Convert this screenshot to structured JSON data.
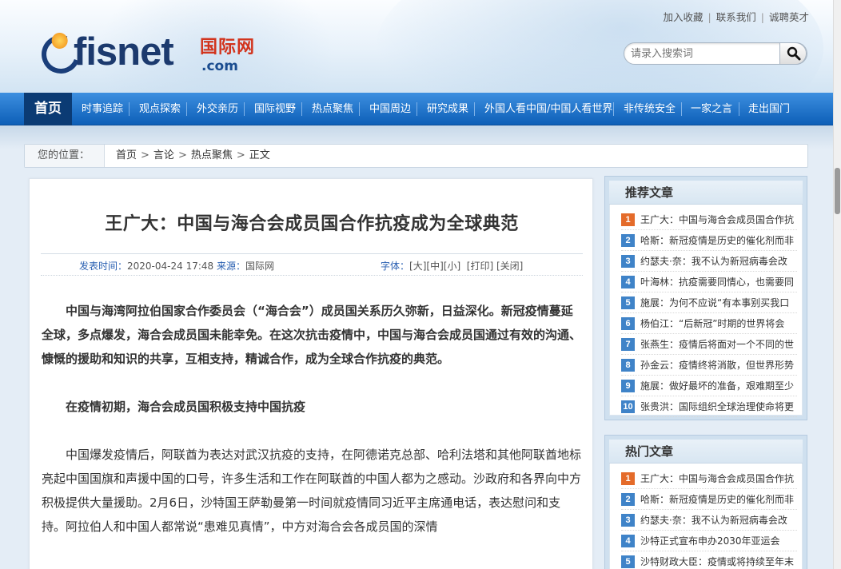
{
  "top_links": [
    "加入收藏",
    "联系我们",
    "诚聘英才"
  ],
  "top_links_sep": "|",
  "logo": {
    "brand": "fisnet",
    "cn": "国际网",
    "domain": ".com"
  },
  "search": {
    "placeholder": "请录入搜索词"
  },
  "nav": {
    "home": "首页",
    "items": [
      "时事追踪",
      "观点探索",
      "外交亲历",
      "国际视野",
      "热点聚焦",
      "中国周边",
      "研究成果",
      "外国人看中国/中国人看世界",
      "非传统安全",
      "一家之言",
      "走出国门"
    ]
  },
  "breadcrumb": {
    "label": "您的位置：",
    "path": [
      "首页",
      "言论",
      "热点聚焦",
      "正文"
    ],
    "sep": ">"
  },
  "article": {
    "title": "王广大：中国与海合会成员国合作抗疫成为全球典范",
    "publish_label": "发表时间：",
    "publish_time": "2020-04-24 17:48",
    "source_label": "来源：",
    "source": "国际网",
    "font_label": "字体：",
    "font_sizes": [
      "[大]",
      "[中]",
      "[小]"
    ],
    "print": "[打印]",
    "close": "[关闭]",
    "paragraphs": [
      "中国与海湾阿拉伯国家合作委员会（“海合会”）成员国关系历久弥新，日益深化。新冠疫情蔓延全球，多点爆发，海合会成员国未能幸免。在这次抗击疫情中，中国与海合会成员国通过有效的沟通、慷慨的援助和知识的共享，互相支持，精诚合作，成为全球合作抗疫的典范。",
      "在疫情初期，海合会成员国积极支持中国抗疫",
      "中国爆发疫情后，阿联酋为表达对武汉抗疫的支持，在阿德诺克总部、哈利法塔和其他阿联酋地标亮起中国国旗和声援中国的口号，许多生活和工作在阿联酋的中国人都为之感动。沙政府和各界向中方积极提供大量援助。2月6日，沙特国王萨勒曼第一时间就疫情同习近平主席通电话，表达慰问和支持。阿拉伯人和中国人都常说“患难见真情”，中方对海合会各成员国的深情"
    ]
  },
  "recommended": {
    "title": "推荐文章",
    "items": [
      "王广大：中国与海合会成员国合作抗",
      "哈斯：新冠疫情是历史的催化剂而非",
      "约瑟夫·奈：我不认为新冠病毒会改",
      "叶海林：抗疫需要同情心，也需要同",
      "施展：为何不应说“有本事别买我口",
      "杨伯江：“后新冠”时期的世界将会",
      "张燕生：疫情后将面对一个不同的世",
      "孙金云：疫情终将消散，但世界形势",
      "施展：做好最坏的准备，艰难期至少",
      "张贵洪：国际组织全球治理使命将更"
    ]
  },
  "hot": {
    "title": "热门文章",
    "items": [
      "王广大：中国与海合会成员国合作抗",
      "哈斯：新冠疫情是历史的催化剂而非",
      "约瑟夫·奈：我不认为新冠病毒会改",
      "沙特正式宣布申办2030年亚运会",
      "沙特财政大臣：疫情或将持续至年末"
    ]
  },
  "colors": {
    "nav_blue": "#1a6fcc",
    "nav_home": "#0b3b74",
    "link_blue": "#2a60b2",
    "badge_top": "#e46b2a",
    "badge": "#3f83c8"
  }
}
